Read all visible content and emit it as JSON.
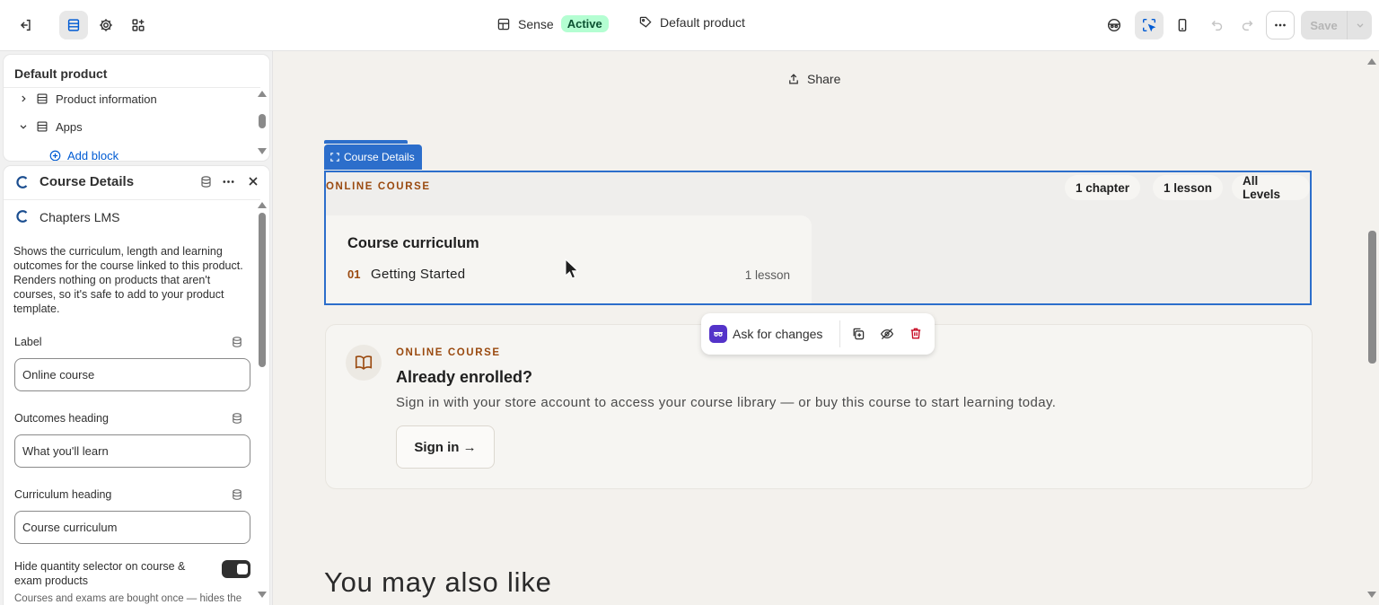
{
  "topbar": {
    "theme_name": "Sense",
    "theme_status": "Active",
    "template_name": "Default product",
    "save_label": "Save"
  },
  "sidebar": {
    "tree": {
      "title": "Default product",
      "items": [
        {
          "label": "Product information",
          "expanded": false
        },
        {
          "label": "Apps",
          "expanded": true
        }
      ],
      "add_block_label": "Add block"
    },
    "block": {
      "title": "Course Details",
      "app_name": "Chapters LMS",
      "description": "Shows the curriculum, length and learning outcomes for the course linked to this product. Renders nothing on products that aren't courses, so it's safe to add to your product template.",
      "fields": [
        {
          "label": "Label",
          "value": "Online course"
        },
        {
          "label": "Outcomes heading",
          "value": "What you'll learn"
        },
        {
          "label": "Curriculum heading",
          "value": "Course curriculum"
        }
      ],
      "toggle_label": "Hide quantity selector on course & exam products",
      "toggle_on": true,
      "toggle_help": "Courses and exams are bought once — hides the"
    }
  },
  "canvas": {
    "share_label": "Share",
    "block_tag": "Course Details",
    "eyebrow": "ONLINE COURSE",
    "chips": [
      "1 chapter",
      "1 lesson",
      "All Levels"
    ],
    "curriculum": {
      "title": "Course curriculum",
      "chapters": [
        {
          "number": "01",
          "name": "Getting Started",
          "count": "1 lesson"
        }
      ]
    },
    "ask_label": "Ask for changes",
    "enroll": {
      "eyebrow": "ONLINE COURSE",
      "title": "Already enrolled?",
      "text": "Sign in with your store account to access your course library — or buy this course to start learning today.",
      "button": "Sign in →"
    },
    "also_like": "You may also like"
  },
  "colors": {
    "accent_blue": "#2c6ecb",
    "eyebrow_brown": "#9a4a10",
    "active_badge_bg": "#b4fed2",
    "delete_red": "#c70a24"
  }
}
